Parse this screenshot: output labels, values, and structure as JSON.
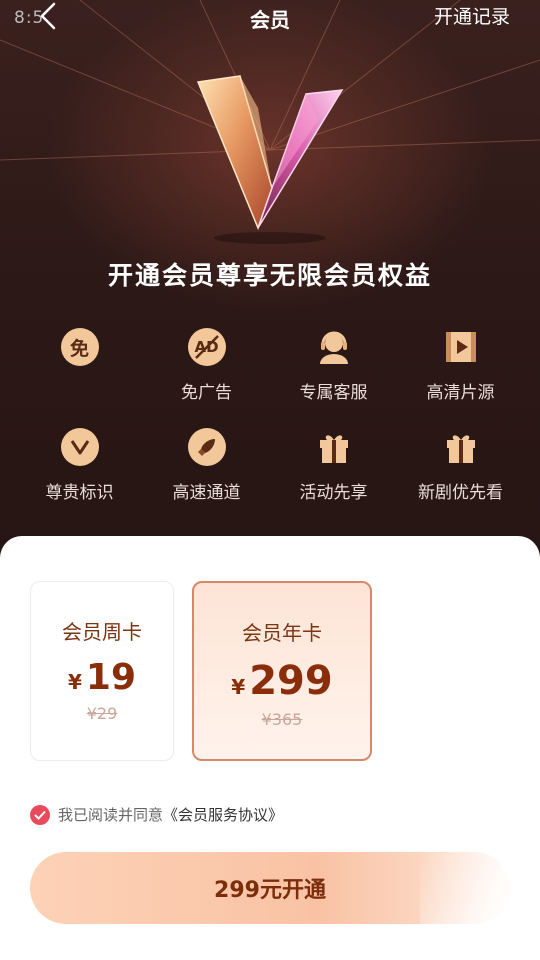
{
  "status": {
    "time": "8:5"
  },
  "nav": {
    "title": "会员",
    "record_label": "开通记录"
  },
  "headline": "开通会员尊享无限会员权益",
  "benefits": [
    {
      "icon_glyph": "免",
      "label": "",
      "icon": "free-icon"
    },
    {
      "icon_glyph": "AD",
      "label": "免广告",
      "icon": "no-ad-icon"
    },
    {
      "icon_glyph": "",
      "label": "专属客服",
      "icon": "customer-service-icon"
    },
    {
      "icon_glyph": "",
      "label": "高清片源",
      "icon": "hd-video-icon"
    },
    {
      "icon_glyph": "",
      "label": "尊贵标识",
      "icon": "vip-badge-icon"
    },
    {
      "icon_glyph": "",
      "label": "高速通道",
      "icon": "rocket-icon"
    },
    {
      "icon_glyph": "",
      "label": "活动先享",
      "icon": "gift-icon"
    },
    {
      "icon_glyph": "",
      "label": "新剧优先看",
      "icon": "gift-icon"
    }
  ],
  "plans": [
    {
      "name": "会员周卡",
      "currency": "¥",
      "price": "19",
      "original": "¥29",
      "selected": false
    },
    {
      "name": "会员年卡",
      "currency": "¥",
      "price": "299",
      "original": "¥365",
      "selected": true
    }
  ],
  "agreement": {
    "text": "我已阅读并同意",
    "link": "《会员服务协议》",
    "checked": true
  },
  "buy_label": "299元开通",
  "colors": {
    "accent": "#8a2d0b",
    "check": "#e84c5c",
    "icon_bg": "#f2c89b"
  }
}
